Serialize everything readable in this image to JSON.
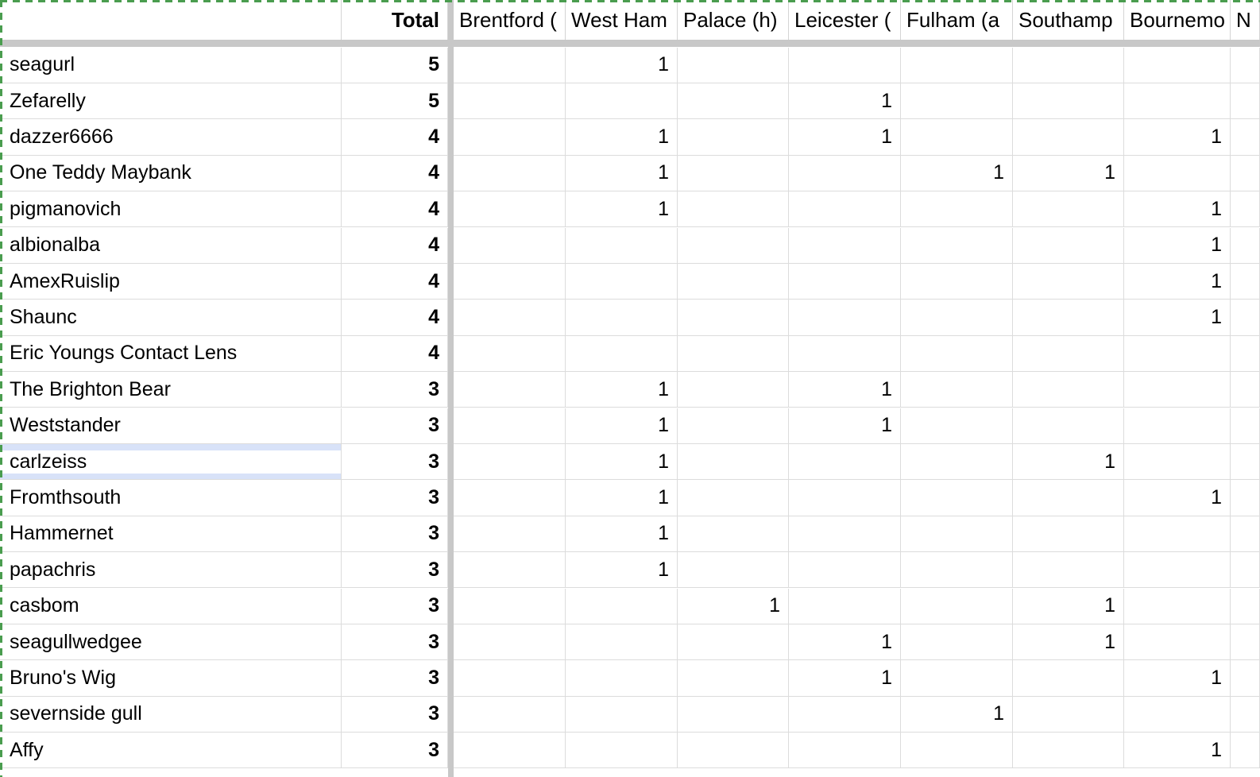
{
  "app": "spreadsheet",
  "grid": {
    "frozen_rows": 1,
    "frozen_columns": 2,
    "accent_color": "#4a9d4f",
    "divider_color": "#c8c8c8",
    "gridline_color": "#dcdcdc",
    "selection_color": "#d8e2f8",
    "selected_row_name": "carlzeiss"
  },
  "header": {
    "name_label": "",
    "total_label": "Total",
    "teams": [
      "Brentford (",
      "West Ham",
      "Palace (h)",
      "Leicester (",
      "Fulham (a",
      "Southamp",
      "Bournemo",
      "N"
    ]
  },
  "chart_data": {
    "type": "table",
    "title": "",
    "columns": [
      "",
      "Total",
      "Brentford (",
      "West Ham",
      "Palace (h)",
      "Leicester (",
      "Fulham (a",
      "Southamp",
      "Bournemo",
      "N"
    ],
    "rows": [
      {
        "name": "seagurl",
        "total": "5",
        "cells": [
          "",
          "1",
          "",
          "",
          "",
          "",
          "",
          ""
        ]
      },
      {
        "name": "Zefarelly",
        "total": "5",
        "cells": [
          "",
          "",
          "",
          "1",
          "",
          "",
          "",
          ""
        ]
      },
      {
        "name": "dazzer6666",
        "total": "4",
        "cells": [
          "",
          "1",
          "",
          "1",
          "",
          "",
          "1",
          ""
        ]
      },
      {
        "name": "One Teddy Maybank",
        "total": "4",
        "cells": [
          "",
          "1",
          "",
          "",
          "1",
          "1",
          "",
          ""
        ]
      },
      {
        "name": "pigmanovich",
        "total": "4",
        "cells": [
          "",
          "1",
          "",
          "",
          "",
          "",
          "1",
          ""
        ]
      },
      {
        "name": "albionalba",
        "total": "4",
        "cells": [
          "",
          "",
          "",
          "",
          "",
          "",
          "1",
          ""
        ]
      },
      {
        "name": "AmexRuislip",
        "total": "4",
        "cells": [
          "",
          "",
          "",
          "",
          "",
          "",
          "1",
          ""
        ]
      },
      {
        "name": "Shaunc",
        "total": "4",
        "cells": [
          "",
          "",
          "",
          "",
          "",
          "",
          "1",
          ""
        ]
      },
      {
        "name": "Eric Youngs Contact Lens",
        "total": "4",
        "cells": [
          "",
          "",
          "",
          "",
          "",
          "",
          "",
          ""
        ]
      },
      {
        "name": "The Brighton Bear",
        "total": "3",
        "cells": [
          "",
          "1",
          "",
          "1",
          "",
          "",
          "",
          ""
        ]
      },
      {
        "name": "Weststander",
        "total": "3",
        "cells": [
          "",
          "1",
          "",
          "1",
          "",
          "",
          "",
          ""
        ]
      },
      {
        "name": "carlzeiss",
        "total": "3",
        "cells": [
          "",
          "1",
          "",
          "",
          "",
          "1",
          "",
          ""
        ]
      },
      {
        "name": "Fromthsouth",
        "total": "3",
        "cells": [
          "",
          "1",
          "",
          "",
          "",
          "",
          "1",
          ""
        ]
      },
      {
        "name": "Hammernet",
        "total": "3",
        "cells": [
          "",
          "1",
          "",
          "",
          "",
          "",
          "",
          ""
        ]
      },
      {
        "name": "papachris",
        "total": "3",
        "cells": [
          "",
          "1",
          "",
          "",
          "",
          "",
          "",
          ""
        ]
      },
      {
        "name": "casbom",
        "total": "3",
        "cells": [
          "",
          "",
          "1",
          "",
          "",
          "1",
          "",
          ""
        ]
      },
      {
        "name": "seagullwedgee",
        "total": "3",
        "cells": [
          "",
          "",
          "",
          "1",
          "",
          "1",
          "",
          ""
        ]
      },
      {
        "name": "Bruno's Wig",
        "total": "3",
        "cells": [
          "",
          "",
          "",
          "1",
          "",
          "",
          "1",
          ""
        ]
      },
      {
        "name": "severnside gull",
        "total": "3",
        "cells": [
          "",
          "",
          "",
          "",
          "1",
          "",
          "",
          ""
        ]
      },
      {
        "name": "Affy",
        "total": "3",
        "cells": [
          "",
          "",
          "",
          "",
          "",
          "",
          "1",
          ""
        ]
      }
    ]
  }
}
